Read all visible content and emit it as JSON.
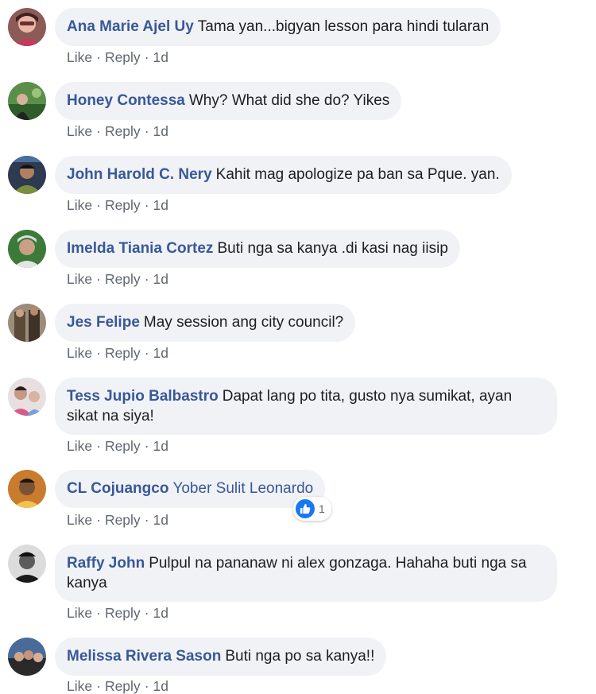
{
  "comments": [
    {
      "author": "Ana Marie Ajel Uy",
      "text": "Tama yan...bigyan lesson para hindi tularan",
      "like": "Like",
      "reply": "Reply",
      "time": "1d"
    },
    {
      "author": "Honey Contessa",
      "text": "Why? What did she do? Yikes",
      "like": "Like",
      "reply": "Reply",
      "time": "1d"
    },
    {
      "author": "John Harold C. Nery",
      "text": "Kahit mag apologize pa ban sa Pque. yan.",
      "like": "Like",
      "reply": "Reply",
      "time": "1d"
    },
    {
      "author": "Imelda Tiania Cortez",
      "text": "Buti nga sa kanya .di kasi nag iisip",
      "like": "Like",
      "reply": "Reply",
      "time": "1d"
    },
    {
      "author": "Jes Felipe",
      "text": "May session ang city council?",
      "like": "Like",
      "reply": "Reply",
      "time": "1d"
    },
    {
      "author": "Tess Jupio Balbastro",
      "text": "Dapat lang po tita, gusto nya sumikat, ayan sikat na siya!",
      "like": "Like",
      "reply": "Reply",
      "time": "1d"
    },
    {
      "author": "CL Cojuangco",
      "text": "Yober Sulit Leonardo",
      "like": "Like",
      "reply": "Reply",
      "time": "1d",
      "reaction_count": "1"
    },
    {
      "author": "Raffy John",
      "text": "Pulpul na pananaw ni alex gonzaga. Hahaha buti nga sa kanya",
      "like": "Like",
      "reply": "Reply",
      "time": "1d"
    },
    {
      "author": "Melissa Rivera Sason",
      "text": "Buti nga po sa kanya!!",
      "like": "Like",
      "reply": "Reply",
      "time": "1d"
    }
  ],
  "colors": {
    "author": "#385898",
    "bubble": "#f0f2f5",
    "meta": "#606770",
    "like_badge": "#1877f2"
  },
  "icons": {
    "reaction": "thumbs-up-icon"
  }
}
